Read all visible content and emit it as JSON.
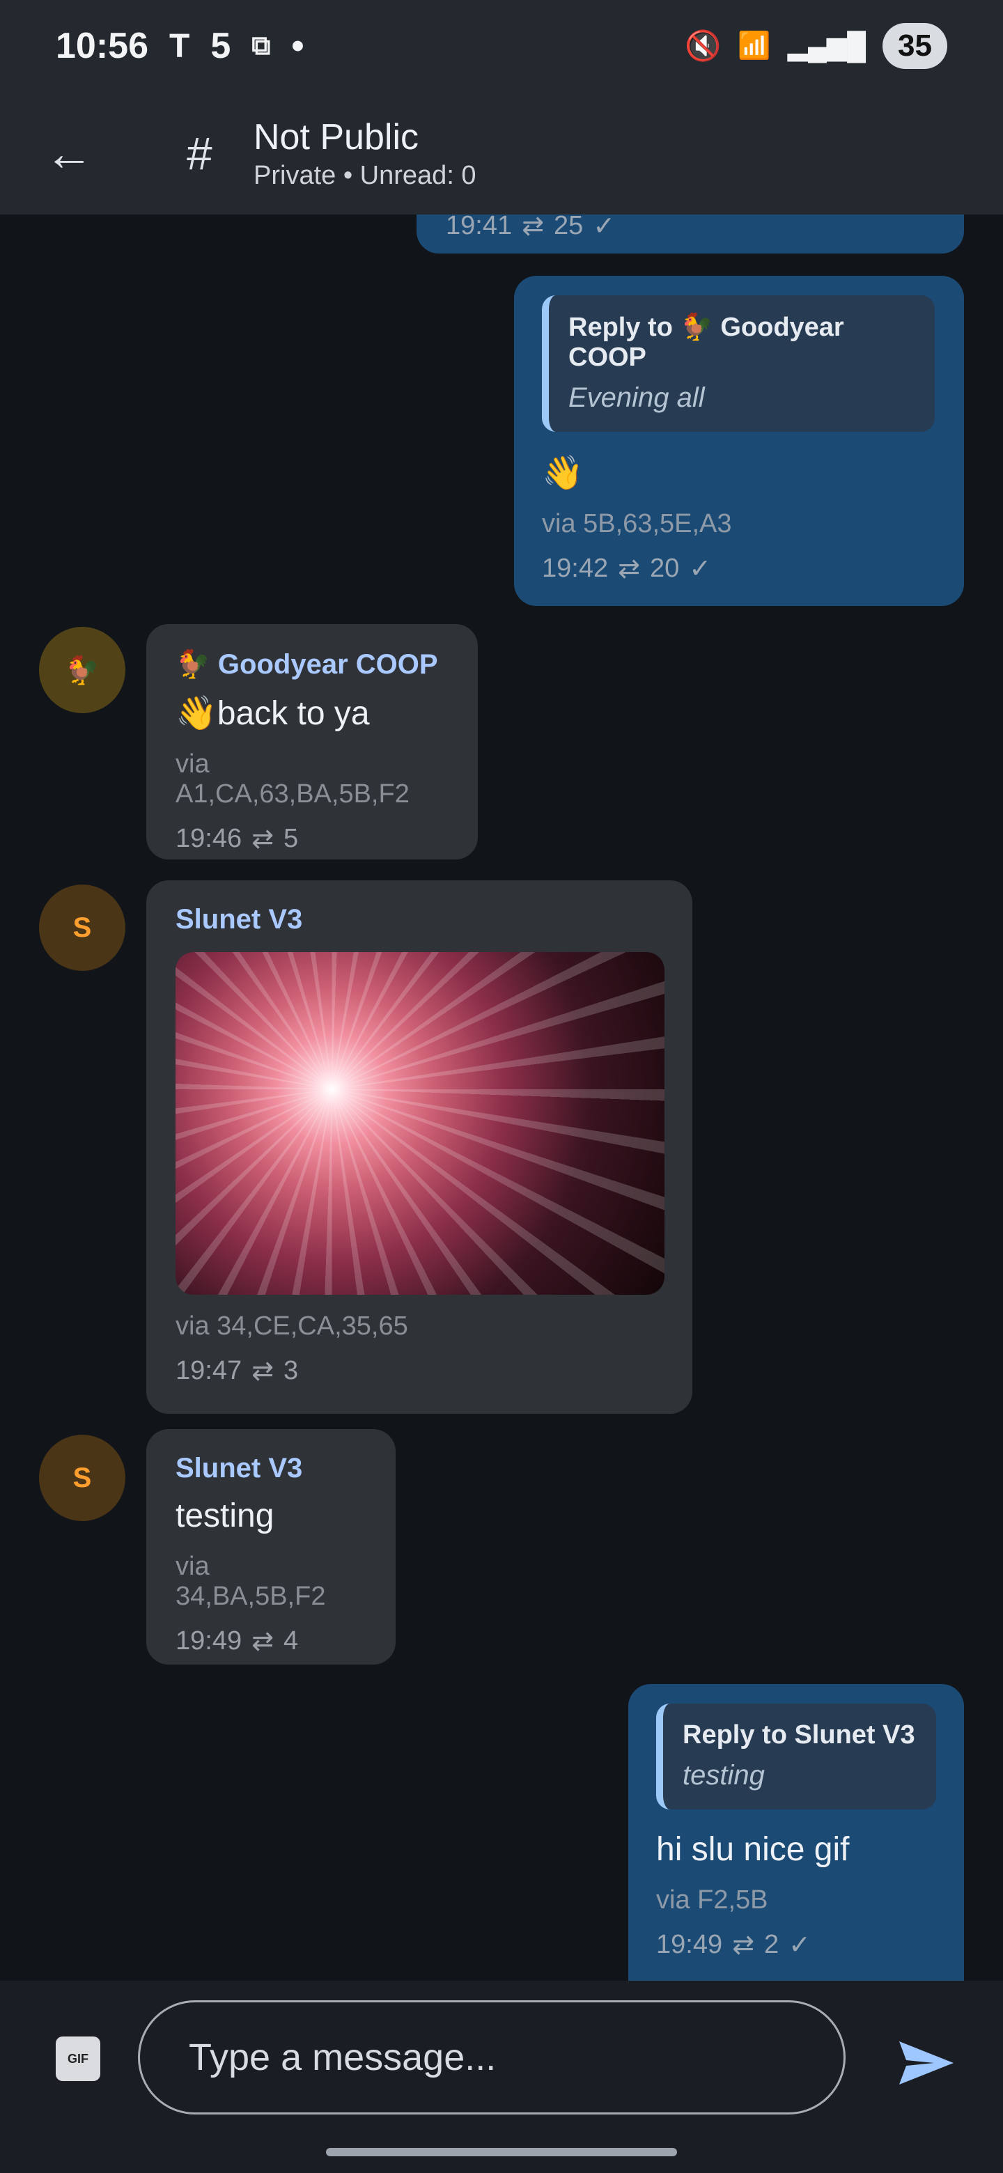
{
  "status_bar": {
    "time": "10:56",
    "count": "5",
    "dot": "•",
    "battery": "35"
  },
  "header": {
    "title": "Not Public",
    "subtitle": "Private • Unread: 0"
  },
  "messages": [
    {
      "id": "top-partial",
      "time": "19:41",
      "repeats": "25"
    },
    {
      "id": "out1",
      "reply_title": "Reply to 🐓 Goodyear COOP",
      "reply_text": "Evening all",
      "text": "👋",
      "via": "via 5B,63,5E,A3",
      "time": "19:42",
      "repeats": "20"
    },
    {
      "id": "in1",
      "avatar": "🐓",
      "sender": "🐓 Goodyear COOP",
      "text": "👋back to ya",
      "via": "via A1,CA,63,BA,5B,F2",
      "time": "19:46",
      "repeats": "5"
    },
    {
      "id": "in2",
      "avatar": "S",
      "sender": "Slunet V3",
      "via": "via 34,CE,CA,35,65",
      "time": "19:47",
      "repeats": "3"
    },
    {
      "id": "in3",
      "avatar": "S",
      "sender": "Slunet V3",
      "text": "testing",
      "via": "via 34,BA,5B,F2",
      "time": "19:49",
      "repeats": "4"
    },
    {
      "id": "out2",
      "reply_title": "Reply to Slunet V3",
      "reply_text": "testing",
      "text": "hi slu nice gif",
      "via": "via F2,5B",
      "time": "19:49",
      "repeats": "2"
    }
  ],
  "composer": {
    "gif_label": "GIF",
    "placeholder": "Type a message..."
  },
  "icons": {
    "back": "arrow-left-icon",
    "hash": "hashtag-icon",
    "repeat": "repeat-icon",
    "check": "check-icon",
    "send": "send-icon"
  },
  "colors": {
    "background": "#111419",
    "out_bubble": "#1b4a74",
    "in_bubble": "#2f3237",
    "accent": "#a9c9ff"
  }
}
